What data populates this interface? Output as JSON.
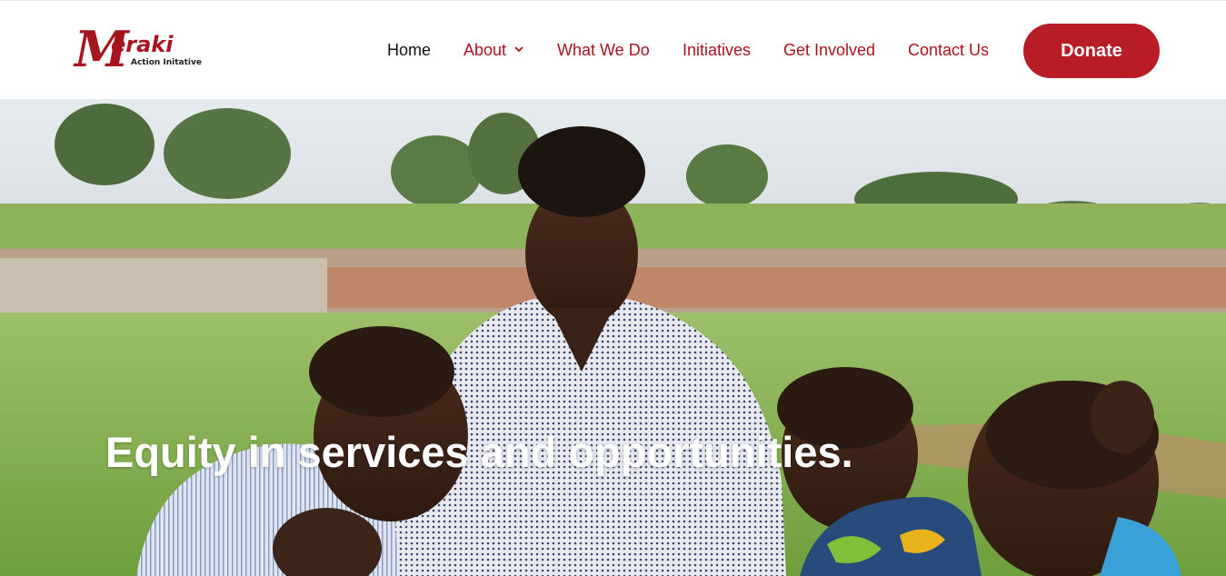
{
  "brand": {
    "name": "eraki",
    "initial": "M",
    "tagline": "Action Initative"
  },
  "nav": {
    "items": [
      {
        "label": "Home",
        "active": true
      },
      {
        "label": "About",
        "has_dropdown": true,
        "icon": "chevron-down-icon"
      },
      {
        "label": "What We Do"
      },
      {
        "label": "Initiatives"
      },
      {
        "label": "Get Involved"
      },
      {
        "label": "Contact Us"
      }
    ],
    "donate_label": "Donate"
  },
  "hero": {
    "headline": "Equity in services and opportunities."
  },
  "colors": {
    "brand": "#a8141e",
    "donate_bg": "#b81c26",
    "nav_active": "#111111"
  }
}
